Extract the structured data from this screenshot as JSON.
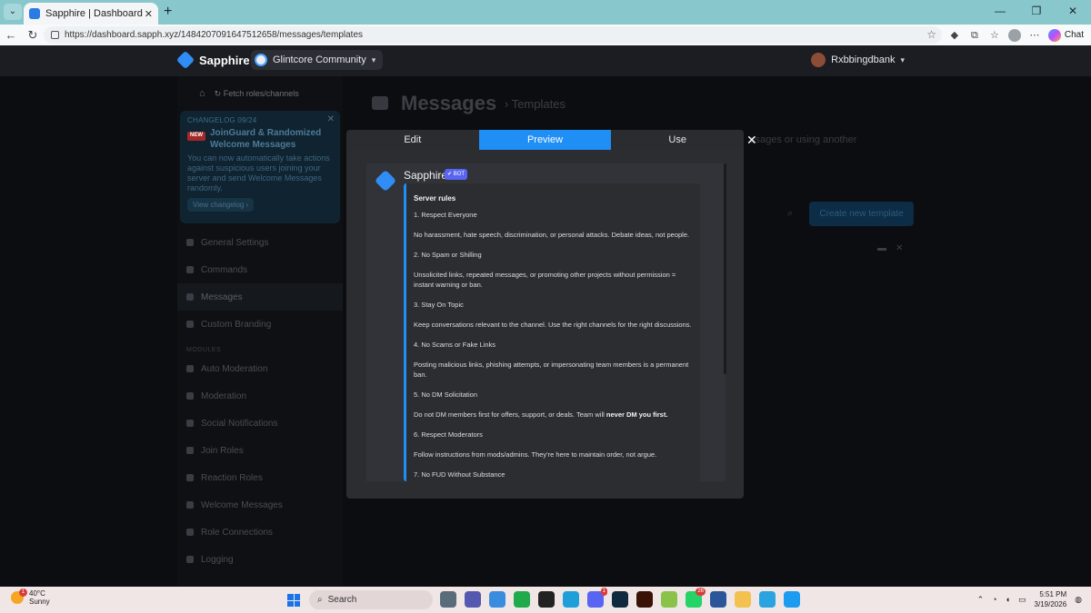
{
  "browser": {
    "tab_title": "Sapphire | Dashboard",
    "url": "https://dashboard.sapph.xyz/1484207091647512658/messages/templates",
    "copilot_label": "Chat"
  },
  "topbar": {
    "brand": "Sapphire",
    "server": "Glintcore Community",
    "user": "Rxbbingdbank"
  },
  "sidebar": {
    "fetch_label": "Fetch roles/channels",
    "changelog": {
      "kicker": "CHANGELOG 09/24",
      "badge": "NEW",
      "title": "JoinGuard & Randomized Welcome Messages",
      "body": "You can now automatically take actions against suspicious users joining your server and send Welcome Messages randomly.",
      "button": "View changelog ›"
    },
    "items": [
      {
        "label": "General Settings"
      },
      {
        "label": "Commands"
      },
      {
        "label": "Messages"
      },
      {
        "label": "Custom Branding"
      }
    ],
    "section_label": "MODULES",
    "modules": [
      {
        "label": "Auto Moderation"
      },
      {
        "label": "Moderation"
      },
      {
        "label": "Social Notifications"
      },
      {
        "label": "Join Roles"
      },
      {
        "label": "Reaction Roles"
      },
      {
        "label": "Welcome Messages"
      },
      {
        "label": "Role Connections"
      },
      {
        "label": "Logging"
      }
    ]
  },
  "main": {
    "title": "Messages",
    "crumb": "›  Templates",
    "desc_fragment": "ssages or using another",
    "create_button": "Create new template"
  },
  "modal": {
    "tabs": [
      "Edit",
      "Preview",
      "Use"
    ],
    "active_tab": "Preview",
    "bot_name": "Sapphire",
    "bot_badge": "✔ BOT",
    "embed_title": "Server rules",
    "rules": [
      "1. Respect Everyone",
      "No harassment, hate speech, discrimination, or personal attacks. Debate ideas, not people.",
      "2. No Spam or Shilling",
      "Unsolicited links, repeated messages, or promoting other projects without permission = instant warning or ban.",
      "3. Stay On Topic",
      "Keep conversations relevant to the channel. Use the right channels for the right discussions.",
      "4. No Scams or Fake Links",
      "Posting malicious links, phishing attempts, or impersonating team members is a permanent ban.",
      "5. No DM Solicitation",
      "Do not DM members first for offers, support, or deals. Team will",
      "6. Respect Moderators",
      "Follow instructions from mods/admins. They're here to maintain order, not argue.",
      "7. No FUD Without Substance"
    ],
    "rule5_bold": "never DM you first."
  },
  "taskbar": {
    "weather_temp": "40°C",
    "weather_text": "Sunny",
    "weather_badge": "1",
    "search_label": "Search",
    "discord_badge": "1",
    "whatsapp_badge": "26",
    "time": "5:51 PM",
    "date": "3/19/2026"
  },
  "colors": {
    "accent": "#1f8ef5",
    "modal_bg": "#2b2d31",
    "embed_bar": "#1f8ef5"
  }
}
